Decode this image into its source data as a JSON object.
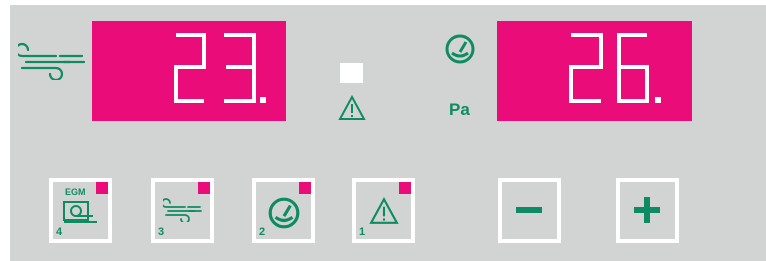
{
  "airflow_display": {
    "value": "23.",
    "color": "#ea0c78"
  },
  "pressure_display": {
    "value": "26.",
    "color": "#ea0c78"
  },
  "pressure_unit": "Pa",
  "icons": {
    "airflow": "airflow-icon",
    "pressure": "pressure-gauge-icon",
    "warning": "warning-triangle-icon",
    "status_light": "status-led-icon"
  },
  "buttons": [
    {
      "label": "EGM",
      "number": "4",
      "icon": "egm-icon",
      "led": true
    },
    {
      "number": "3",
      "icon": "airflow-icon",
      "led": true
    },
    {
      "number": "2",
      "icon": "pressure-gauge-icon",
      "led": true
    },
    {
      "number": "1",
      "icon": "warning-triangle-icon",
      "led": true
    },
    {
      "symbol": "minus",
      "icon": "minus-icon"
    },
    {
      "symbol": "plus",
      "icon": "plus-icon"
    }
  ],
  "colors": {
    "display": "#ea0c78",
    "accent": "#0f8b63",
    "panel": "#d2d4d3"
  }
}
